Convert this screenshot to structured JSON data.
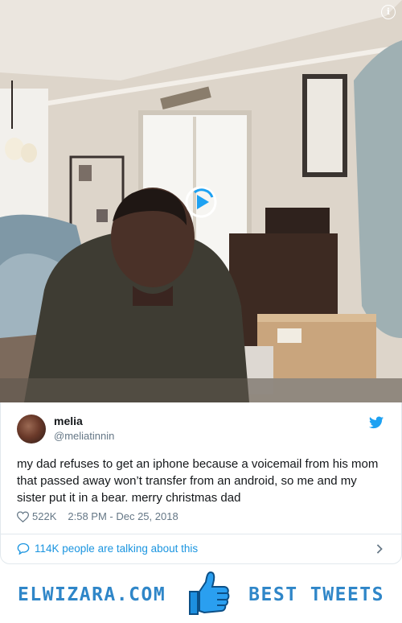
{
  "tweet": {
    "author_name": "melia",
    "author_handle": "@meliatinnin",
    "text": "my dad refuses to get an iphone because a voicemail from his mom that passed away won’t transfer from an android, so me and my sister put it in a bear. merry christmas dad",
    "likes": "522K",
    "timestamp": "2:58 PM - Dec 25, 2018",
    "talking": "114K people are talking about this"
  },
  "footer": {
    "left_text": "ELWIZARA.COM",
    "right_text": "BEST TWEETS"
  },
  "colors": {
    "twitter_blue": "#1da1f2",
    "link_blue": "#1b95e0",
    "footer_blue": "#2f86c8",
    "muted": "#657786"
  },
  "icons": [
    "info-icon",
    "play-icon",
    "twitter-bird-icon",
    "heart-icon",
    "speech-bubble-icon",
    "chevron-right-icon",
    "thumbs-up-icon"
  ]
}
